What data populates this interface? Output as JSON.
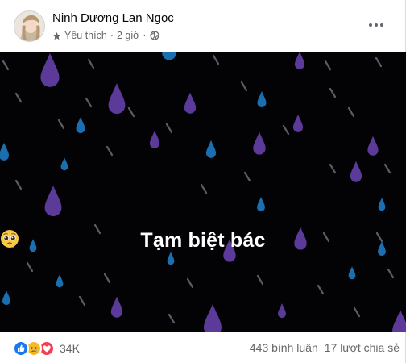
{
  "post": {
    "author_name": "Ninh Dương Lan Ngọc",
    "audience_label": "Yêu thích",
    "separator": "·",
    "time_label": "2 giờ",
    "more_icon": "more-horizontal-icon",
    "caption": "Tạm biệt bác",
    "caption_emoji": "pleading-face-emoji"
  },
  "footer": {
    "reaction_count": "34K",
    "comments_label": "443 bình luận",
    "shares_label": "17 lượt chia sẻ",
    "reactions": [
      "like",
      "sad",
      "love"
    ]
  },
  "colors": {
    "like": "#1877f2",
    "sad": "#f7b928",
    "love": "#f33e58",
    "drop_purple": "#5b3a9a",
    "drop_blue": "#1b6fb0",
    "streak": "#6c6c78",
    "background": "#030204"
  }
}
